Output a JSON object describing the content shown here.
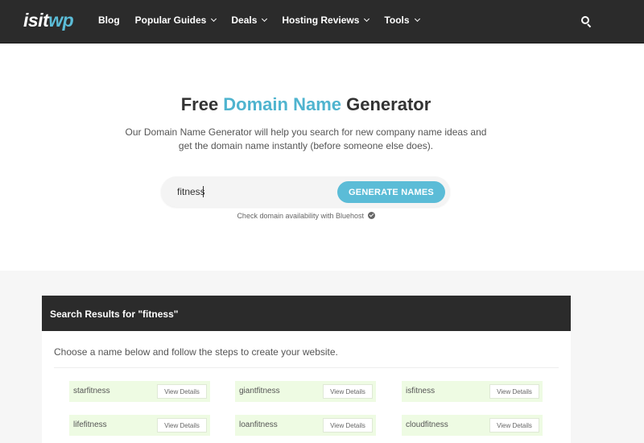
{
  "header": {
    "logo_part1": "isit",
    "logo_part2": "wp",
    "nav": [
      {
        "label": "Blog",
        "dropdown": false
      },
      {
        "label": "Popular Guides",
        "dropdown": true
      },
      {
        "label": "Deals",
        "dropdown": true
      },
      {
        "label": "Hosting Reviews",
        "dropdown": true
      },
      {
        "label": "Tools",
        "dropdown": true
      }
    ],
    "search_icon": "search-icon"
  },
  "hero": {
    "title_pre": "Free ",
    "title_highlight": "Domain Name",
    "title_post": " Generator",
    "description": "Our Domain Name Generator will help you search for new company name ideas and get the domain name instantly (before someone else does).",
    "search_value": "fitness",
    "generate_button": "GENERATE NAMES",
    "availability_note": "Check domain availability with Bluehost"
  },
  "results": {
    "heading": "Search Results for \"fitness\"",
    "instructions": "Choose a name below and follow the steps to create your website.",
    "view_details_label": "View Details",
    "names": [
      "starfitness",
      "giantfitness",
      "isfitness",
      "lifefitness",
      "loanfitness",
      "cloudfitness"
    ]
  },
  "colors": {
    "header_bg": "#2b2b2b",
    "accent": "#5bbcd7",
    "card_bg": "#eefbe3"
  }
}
